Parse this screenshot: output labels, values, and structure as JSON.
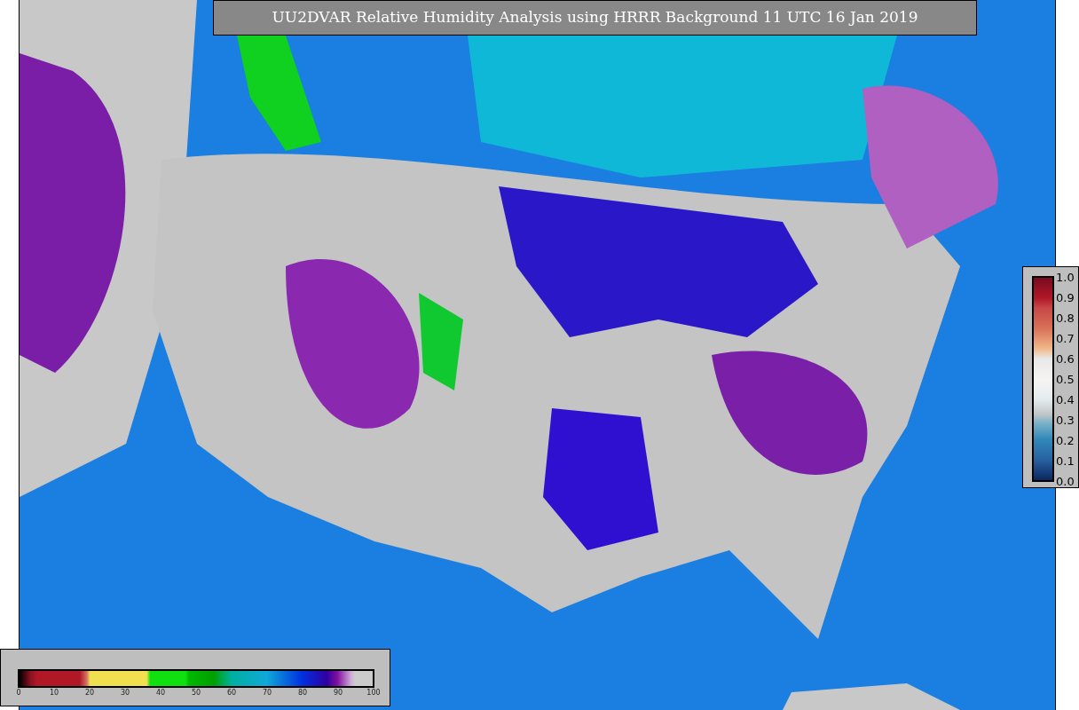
{
  "title": "UU2DVAR Relative Humidity Analysis using HRRR Background 11 UTC 16 Jan 2019",
  "humidity_colorbar": {
    "ticks": [
      "0",
      "10",
      "20",
      "30",
      "40",
      "50",
      "60",
      "70",
      "80",
      "90",
      "100"
    ]
  },
  "observation_colorbar": {
    "ticks": [
      "1.0",
      "0.9",
      "0.8",
      "0.7",
      "0.6",
      "0.5",
      "0.4",
      "0.3",
      "0.2",
      "0.1",
      "0.0"
    ]
  }
}
